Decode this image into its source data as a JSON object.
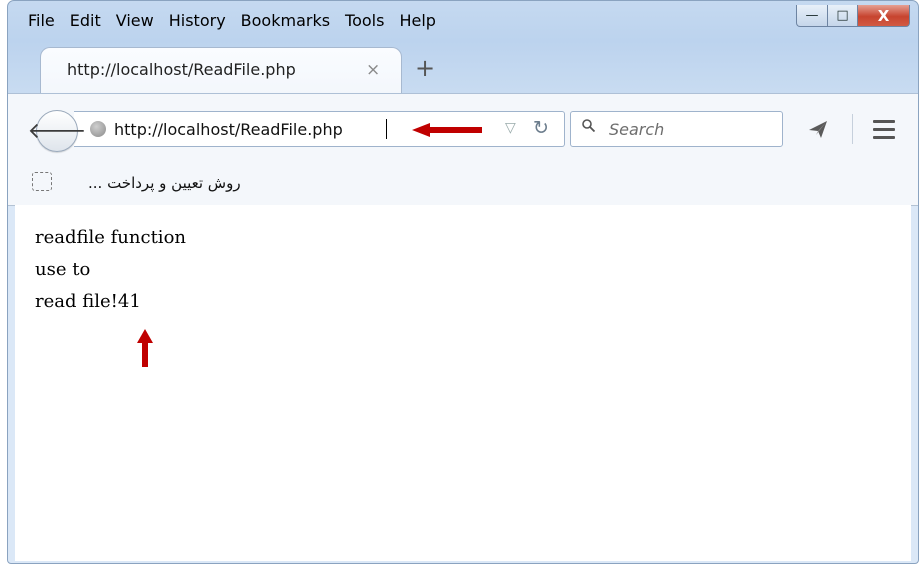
{
  "menu": [
    "File",
    "Edit",
    "View",
    "History",
    "Bookmarks",
    "Tools",
    "Help"
  ],
  "window_controls": {
    "minimize": "—",
    "maximize": "□",
    "close": "X"
  },
  "tab": {
    "title": "http://localhost/ReadFile.php",
    "close": "×",
    "new_tab": "+"
  },
  "address": {
    "url": "http://localhost/ReadFile.php"
  },
  "search": {
    "placeholder": "Search"
  },
  "bookmarks": {
    "item": "... روش تعیین و پرداخت"
  },
  "page": {
    "lines": [
      "readfile function",
      "use to",
      "read file!41"
    ]
  },
  "colors": {
    "annotation_arrow": "#c00000",
    "titlebar": "#c5d9f0"
  }
}
